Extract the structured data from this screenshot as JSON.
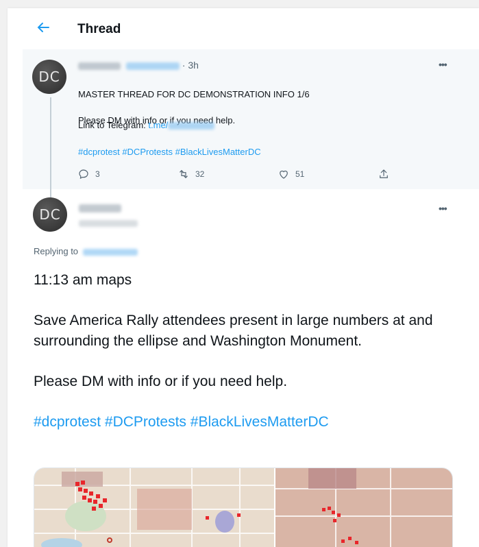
{
  "header": {
    "back_icon": "back-arrow-icon",
    "title": "Thread"
  },
  "parent_tweet": {
    "avatar_text": "DC",
    "time": "· 3h",
    "text_line1": "MASTER THREAD FOR DC DEMONSTRATION INFO 1/6",
    "text_line2": "Please DM with info or if you need help.",
    "link_label": "Link to Telegram:",
    "link_text": "t.me/",
    "hashtags": "#dcprotest #DCProtests #BlackLivesMatterDC",
    "replies": "3",
    "retweets": "32",
    "likes": "51"
  },
  "reply_tweet": {
    "avatar_text": "DC",
    "replying_to": "Replying to",
    "line1": "11:13 am maps",
    "para2": "Save America Rally attendees present in large numbers at and surrounding the ellipse and Washington Monument.",
    "para3": "Please DM with info or if you need help.",
    "hashtags": "#dcprotest #DCProtests #BlackLivesMatterDC"
  },
  "colors": {
    "accent": "#1d9bf0",
    "muted": "#536471",
    "marker": "#e8262b"
  }
}
